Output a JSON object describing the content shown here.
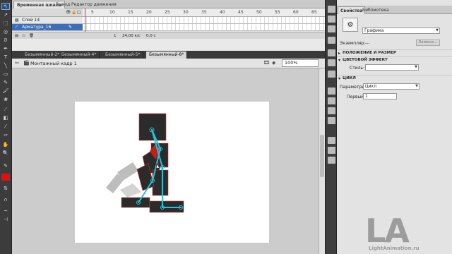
{
  "timeline": {
    "tabs": [
      {
        "label": "Временная шкала",
        "active": true
      },
      {
        "label": "Вывод",
        "active": false
      },
      {
        "label": "Редактор движения",
        "active": false
      }
    ],
    "ruler_ticks": [
      "5",
      "10",
      "15",
      "20",
      "25",
      "30",
      "35",
      "40",
      "45",
      "50",
      "55",
      "60",
      "65"
    ],
    "layers": [
      {
        "name": "Слой 14",
        "selected": false
      },
      {
        "name": "Арматура_16",
        "selected": true
      }
    ],
    "footer": {
      "frame": "1",
      "fps": "24,00 к/с",
      "time": "0,0 с"
    }
  },
  "document_tabs": [
    {
      "label": "Безымянный-2*",
      "active": false
    },
    {
      "label": "Безымянный-4*",
      "active": false
    },
    {
      "label": "Безымянный-5*",
      "active": false
    },
    {
      "label": "Безымянный-8*",
      "active": true
    }
  ],
  "editbar": {
    "scene": "Монтажный кадр 1",
    "zoom": "100%"
  },
  "properties": {
    "tabs": [
      {
        "label": "Свойства",
        "active": true
      },
      {
        "label": "Библиотека",
        "active": false
      }
    ],
    "symbol_type": "Графика",
    "instance_label": "Экземпляр:",
    "instance_value": "---",
    "swap_button": "Замена...",
    "sections": {
      "position": "ПОЛОЖЕНИЕ И РАЗМЕР",
      "color": "ЦВЕТОВОЙ ЭФФЕКТ",
      "loop": "ЦИКЛ"
    },
    "style_label": "Стиль:",
    "style_value": "",
    "params_label": "Параметры:",
    "params_value": "Цикл",
    "first_label": "Первый:",
    "first_value": "1"
  },
  "watermark": {
    "logo": "LA",
    "sub": "LightAnimation.ru"
  },
  "colors": {
    "accent": "#3d6fb8",
    "bone": "#23c4dc",
    "shape": "#2a2a2a",
    "playhead": "#dd3333"
  }
}
